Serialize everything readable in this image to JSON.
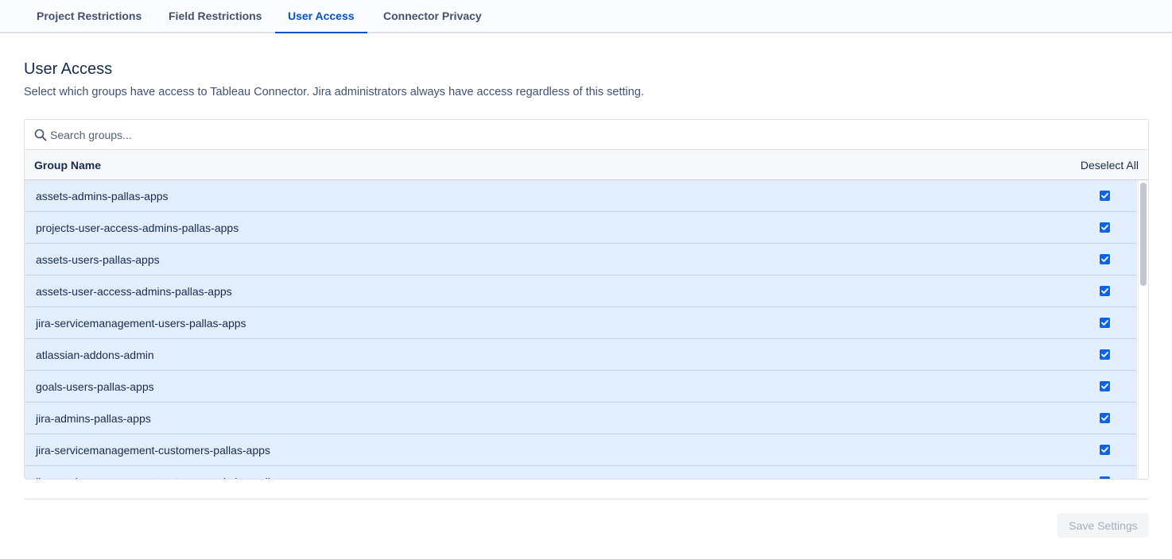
{
  "tabs": [
    {
      "label": "Project Restrictions",
      "active": false
    },
    {
      "label": "Field Restrictions",
      "active": false
    },
    {
      "label": "User Access",
      "active": true
    },
    {
      "label": "Connector Privacy",
      "active": false
    }
  ],
  "section": {
    "title": "User Access",
    "description": "Select which groups have access to Tableau Connector. Jira administrators always have access regardless of this setting."
  },
  "search": {
    "placeholder": "Search groups...",
    "value": ""
  },
  "table": {
    "header_name": "Group Name",
    "header_action": "Deselect All",
    "rows": [
      {
        "name": "assets-admins-pallas-apps",
        "checked": true
      },
      {
        "name": "projects-user-access-admins-pallas-apps",
        "checked": true
      },
      {
        "name": "assets-users-pallas-apps",
        "checked": true
      },
      {
        "name": "assets-user-access-admins-pallas-apps",
        "checked": true
      },
      {
        "name": "jira-servicemanagement-users-pallas-apps",
        "checked": true
      },
      {
        "name": "atlassian-addons-admin",
        "checked": true
      },
      {
        "name": "goals-users-pallas-apps",
        "checked": true
      },
      {
        "name": "jira-admins-pallas-apps",
        "checked": true
      },
      {
        "name": "jira-servicemanagement-customers-pallas-apps",
        "checked": true
      },
      {
        "name": "jira-servicemanagement-customers-admins-pallas-apps",
        "checked": true
      }
    ]
  },
  "footer": {
    "save_label": "Save Settings"
  },
  "colors": {
    "accent": "#0052cc",
    "row_selected": "#e3eefc",
    "checkbox": "#0c66e4"
  }
}
